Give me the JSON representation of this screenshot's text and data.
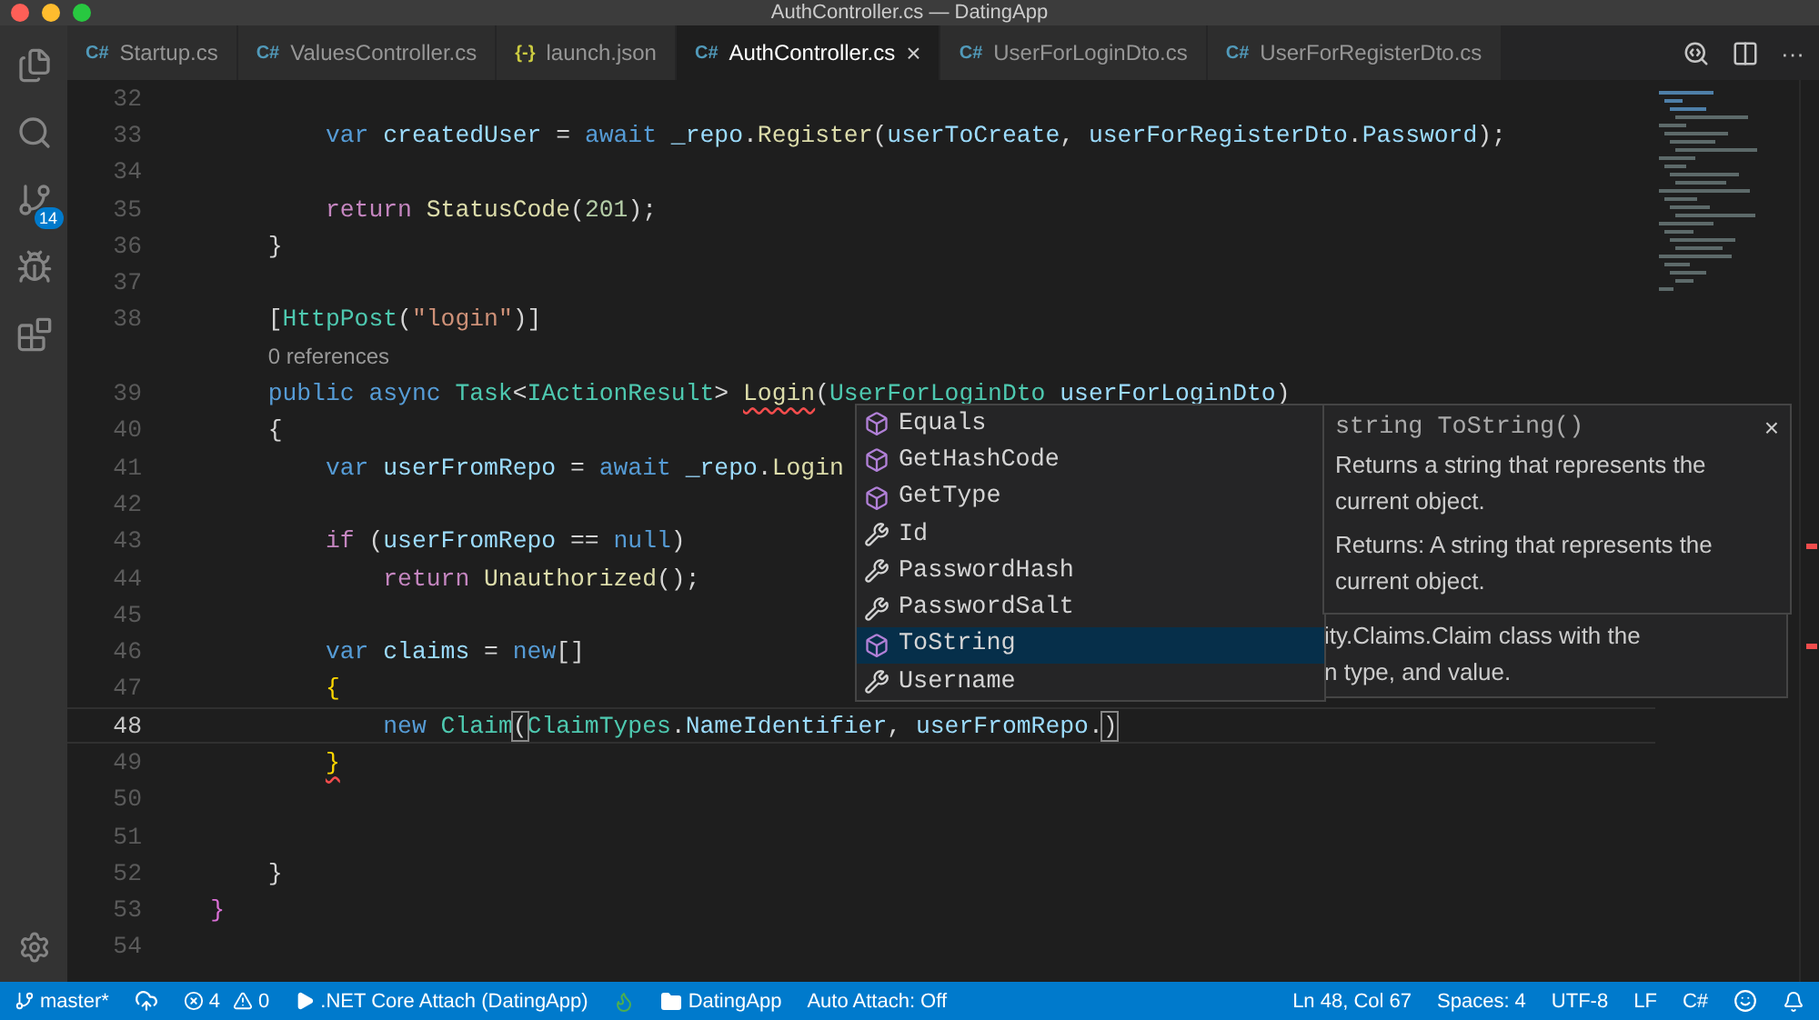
{
  "window": {
    "title": "AuthController.cs — DatingApp"
  },
  "activity_bar": {
    "source_control_badge": "14"
  },
  "tabs": [
    {
      "icon_text": "C#",
      "kind": "csharp",
      "label": "Startup.cs",
      "selected": false
    },
    {
      "icon_text": "C#",
      "kind": "csharp",
      "label": "ValuesController.cs",
      "selected": false
    },
    {
      "icon_text": "{-}",
      "kind": "json",
      "label": "launch.json",
      "selected": false
    },
    {
      "icon_text": "C#",
      "kind": "csharp",
      "label": "AuthController.cs",
      "selected": true,
      "close": "×"
    },
    {
      "icon_text": "C#",
      "kind": "csharp",
      "label": "UserForLoginDto.cs",
      "selected": false
    },
    {
      "icon_text": "C#",
      "kind": "csharp",
      "label": "UserForRegisterDto.cs",
      "selected": false
    }
  ],
  "tab_actions": {
    "more": "···"
  },
  "editor": {
    "lines": [
      {
        "number": "32",
        "current": false
      },
      {
        "number": "33",
        "current": false,
        "tokens": [
          {
            "kind": "keyword",
            "text": "            var"
          },
          {
            "kind": "variable",
            "text": " createdUser"
          },
          {
            "kind": "plain",
            "text": " = "
          },
          {
            "kind": "keyword",
            "text": "await"
          },
          {
            "kind": "variable",
            "text": " _repo"
          },
          {
            "kind": "plain",
            "text": "."
          },
          {
            "kind": "method",
            "text": "Register"
          },
          {
            "kind": "plain",
            "text": "("
          },
          {
            "kind": "variable",
            "text": "userToCreate"
          },
          {
            "kind": "plain",
            "text": ", "
          },
          {
            "kind": "variable",
            "text": "userForRegisterDto"
          },
          {
            "kind": "plain",
            "text": "."
          },
          {
            "kind": "variable",
            "text": "Password"
          },
          {
            "kind": "plain",
            "text": ");"
          }
        ]
      },
      {
        "number": "34",
        "current": false
      },
      {
        "number": "35",
        "current": false,
        "tokens": [
          {
            "kind": "keyword2",
            "text": "            return"
          },
          {
            "kind": "method",
            "text": " StatusCode"
          },
          {
            "kind": "plain",
            "text": "("
          },
          {
            "kind": "number",
            "text": "201"
          },
          {
            "kind": "plain",
            "text": ");"
          }
        ]
      },
      {
        "number": "36",
        "current": false,
        "tokens": [
          {
            "kind": "plain",
            "text": "        }"
          }
        ]
      },
      {
        "number": "37",
        "current": false
      },
      {
        "number": "38",
        "current": false,
        "tokens": [
          {
            "kind": "plain",
            "text": "        ["
          },
          {
            "kind": "type",
            "text": "HttpPost"
          },
          {
            "kind": "plain",
            "text": "("
          },
          {
            "kind": "string",
            "text": "\"login\""
          },
          {
            "kind": "plain",
            "text": ")]"
          }
        ],
        "lens": "0 references"
      },
      {
        "number": "39",
        "current": false,
        "tokens": [
          {
            "kind": "keyword",
            "text": "        public"
          },
          {
            "kind": "keyword",
            "text": " async"
          },
          {
            "kind": "type",
            "text": " Task"
          },
          {
            "kind": "plain",
            "text": "<"
          },
          {
            "kind": "type",
            "text": "IActionResult"
          },
          {
            "kind": "plain",
            "text": "> "
          },
          {
            "kind": "method",
            "text": "Login",
            "squiggle": true
          },
          {
            "kind": "plain",
            "text": "("
          },
          {
            "kind": "type",
            "text": "UserForLoginDto"
          },
          {
            "kind": "variable",
            "text": " userForLoginDto"
          },
          {
            "kind": "plain",
            "text": ")"
          }
        ]
      },
      {
        "number": "40",
        "current": false,
        "tokens": [
          {
            "kind": "plain",
            "text": "        {"
          }
        ]
      },
      {
        "number": "41",
        "current": false,
        "tokens": [
          {
            "kind": "keyword",
            "text": "            var"
          },
          {
            "kind": "variable",
            "text": " userFromRepo"
          },
          {
            "kind": "plain",
            "text": " = "
          },
          {
            "kind": "keyword",
            "text": "await"
          },
          {
            "kind": "variable",
            "text": " _repo"
          },
          {
            "kind": "plain",
            "text": "."
          },
          {
            "kind": "method",
            "text": "Login"
          }
        ]
      },
      {
        "number": "42",
        "current": false
      },
      {
        "number": "43",
        "current": false,
        "tokens": [
          {
            "kind": "keyword2",
            "text": "            if"
          },
          {
            "kind": "plain",
            "text": " ("
          },
          {
            "kind": "variable",
            "text": "userFromRepo"
          },
          {
            "kind": "plain",
            "text": " == "
          },
          {
            "kind": "keyword",
            "text": "null"
          },
          {
            "kind": "plain",
            "text": ")"
          }
        ]
      },
      {
        "number": "44",
        "current": false,
        "tokens": [
          {
            "kind": "keyword2",
            "text": "                return"
          },
          {
            "kind": "method",
            "text": " Unauthorized"
          },
          {
            "kind": "plain",
            "text": "();"
          }
        ]
      },
      {
        "number": "45",
        "current": false
      },
      {
        "number": "46",
        "current": false,
        "tokens": [
          {
            "kind": "keyword",
            "text": "            var"
          },
          {
            "kind": "variable",
            "text": " claims"
          },
          {
            "kind": "plain",
            "text": " = "
          },
          {
            "kind": "keyword",
            "text": "new"
          },
          {
            "kind": "plain",
            "text": "[]"
          }
        ]
      },
      {
        "number": "47",
        "current": false,
        "tokens": [
          {
            "kind": "bracket",
            "text": "            {"
          }
        ]
      },
      {
        "number": "48",
        "current": true,
        "tokens": [
          {
            "kind": "keyword",
            "text": "                new"
          },
          {
            "kind": "type",
            "text": " Claim"
          },
          {
            "kind": "match",
            "text": "("
          },
          {
            "kind": "type",
            "text": "ClaimTypes"
          },
          {
            "kind": "plain",
            "text": "."
          },
          {
            "kind": "variable",
            "text": "NameIdentifier"
          },
          {
            "kind": "plain",
            "text": ", "
          },
          {
            "kind": "variable",
            "text": "userFromRepo"
          },
          {
            "kind": "plain",
            "text": "."
          },
          {
            "kind": "match",
            "text": ")"
          }
        ]
      },
      {
        "number": "49",
        "current": false,
        "tokens": [
          {
            "kind": "bracket",
            "text": "            }",
            "squiggle": true
          }
        ]
      },
      {
        "number": "50",
        "current": false
      },
      {
        "number": "51",
        "current": false
      },
      {
        "number": "52",
        "current": false,
        "tokens": [
          {
            "kind": "plain",
            "text": "        }"
          }
        ]
      },
      {
        "number": "53",
        "current": false,
        "tokens": [
          {
            "kind": "bracket2",
            "text": "    }"
          }
        ]
      },
      {
        "number": "54",
        "current": false
      }
    ]
  },
  "hover_hint": {
    "lines": [
      "ity.Claims.Claim  class with the",
      "n type, and value."
    ]
  },
  "suggestions": {
    "items": [
      {
        "kind": "method",
        "label": "Equals",
        "selected": false
      },
      {
        "kind": "method",
        "label": "GetHashCode",
        "selected": false
      },
      {
        "kind": "method",
        "label": "GetType",
        "selected": false
      },
      {
        "kind": "property",
        "label": "Id",
        "selected": false
      },
      {
        "kind": "property",
        "label": "PasswordHash",
        "selected": false
      },
      {
        "kind": "property",
        "label": "PasswordSalt",
        "selected": false
      },
      {
        "kind": "method",
        "label": "ToString",
        "selected": true
      },
      {
        "kind": "property",
        "label": "Username",
        "selected": false
      }
    ],
    "details": {
      "signature": "string ToString()",
      "close": "×",
      "paragraphs": [
        "Returns a string that represents the current object.",
        "Returns: A string that represents the current object."
      ]
    }
  },
  "status_bar": {
    "branch": "master*",
    "errors": "4",
    "warnings": "0",
    "debug": ".NET Core Attach (DatingApp)",
    "folder": "DatingApp",
    "auto_attach": "Auto Attach: Off",
    "position": "Ln 48, Col 67",
    "spaces": "Spaces: 4",
    "encoding": "UTF-8",
    "eol": "LF",
    "language": "C#"
  }
}
